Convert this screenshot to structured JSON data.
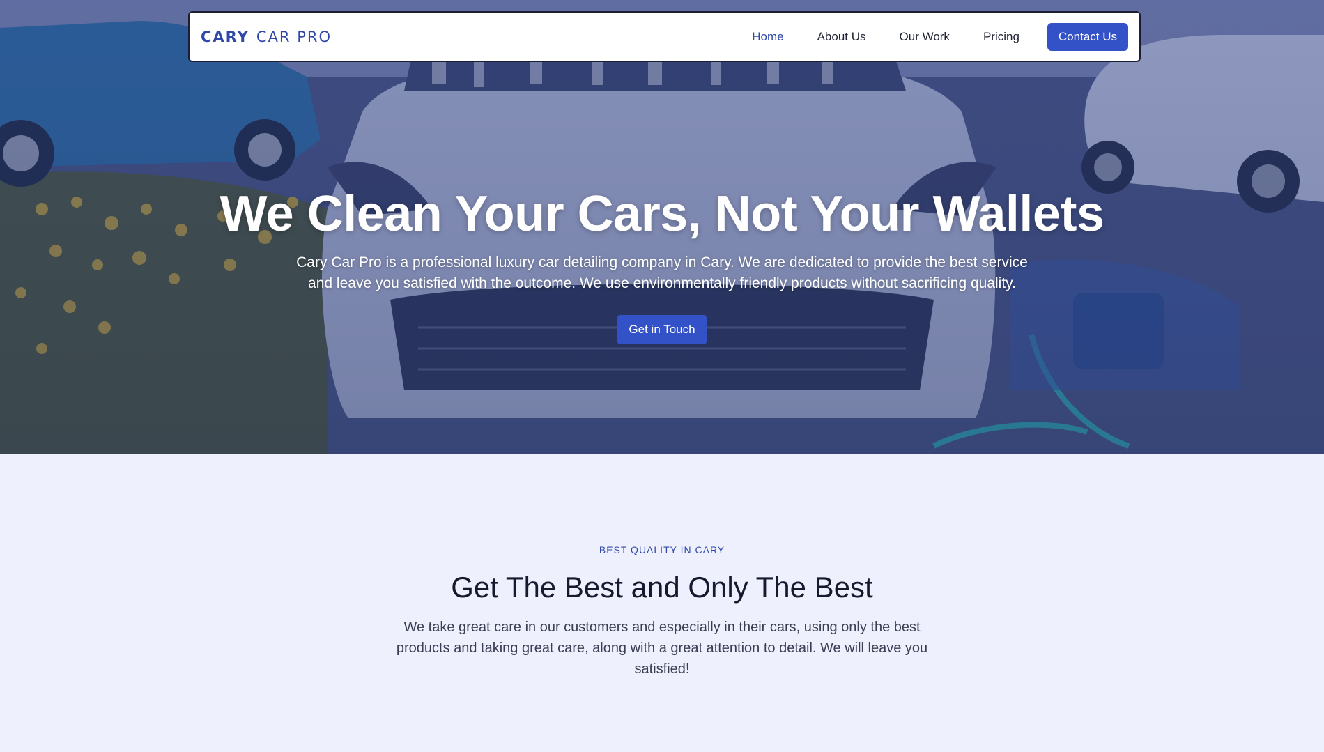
{
  "brand": {
    "logo_part1": "CARY",
    "logo_part2": "CAR PRO"
  },
  "nav": {
    "items": [
      {
        "label": "Home",
        "active": true
      },
      {
        "label": "About Us",
        "active": false
      },
      {
        "label": "Our Work",
        "active": false
      },
      {
        "label": "Pricing",
        "active": false
      }
    ],
    "cta_label": "Contact Us"
  },
  "hero": {
    "title": "We Clean Your Cars, Not Your Wallets",
    "subtitle": "Cary Car Pro is a professional luxury car detailing company in Cary. We are dedicated to provide the best service and leave you satisfied with the outcome. We use environmentally friendly products without sacrificing quality.",
    "button_label": "Get in Touch"
  },
  "section": {
    "eyebrow": "BEST QUALITY IN CARY",
    "title": "Get The Best and Only The Best",
    "text": "We take great care in our customers and especially in their cars, using only the best products and taking great care, along with a great attention to detail. We will leave you satisfied!"
  },
  "colors": {
    "accent": "#3352c7",
    "brand_text": "#2f48a8",
    "section_bg": "#eef1fd",
    "hero_overlay": "#3b4d8e"
  }
}
